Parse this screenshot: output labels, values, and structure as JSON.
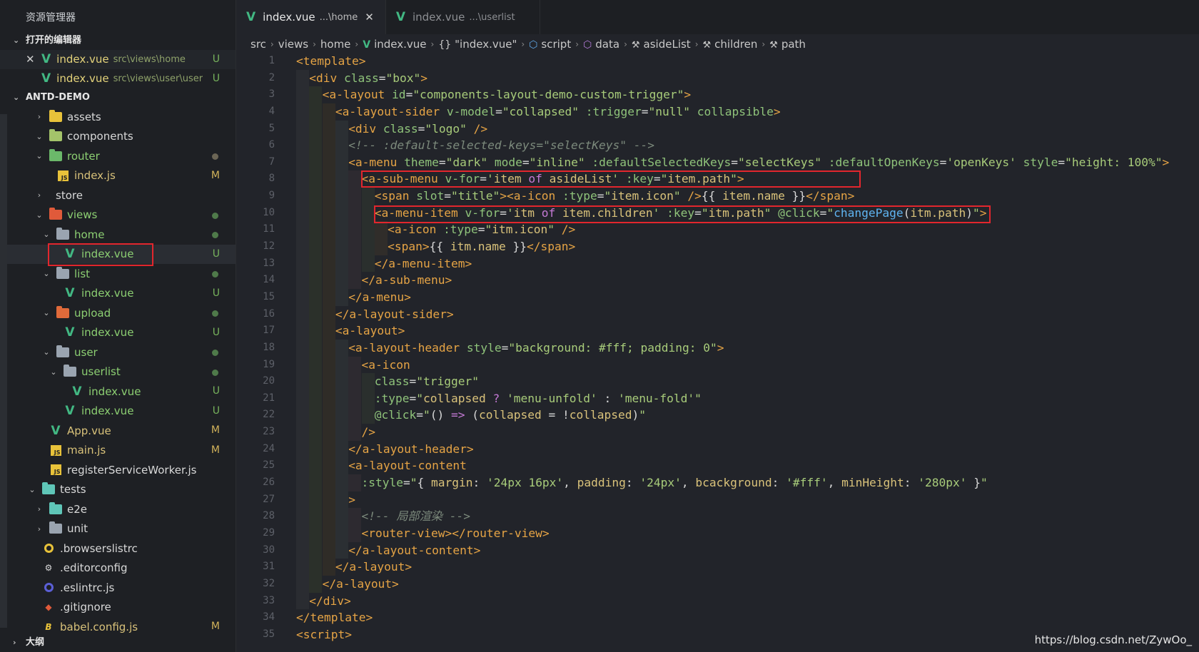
{
  "sidebar": {
    "title": "资源管理器",
    "open_editors_label": "打开的编辑器",
    "open_editors": [
      {
        "name": "index.vue",
        "path": "src\\views\\home",
        "badge": "U",
        "closable": true
      },
      {
        "name": "index.vue",
        "path": "src\\views\\user\\user...",
        "badge": "U",
        "closable": false
      }
    ],
    "project_label": "ANTD-DEMO",
    "tree": [
      {
        "label": "assets",
        "depth": 0,
        "chev": "›",
        "icon": "folder",
        "color": "#e8c23a",
        "badge": "",
        "dot": ""
      },
      {
        "label": "components",
        "depth": 0,
        "chev": "⌄",
        "icon": "folder",
        "color": "#a4c46a",
        "badge": "",
        "dot": ""
      },
      {
        "label": "router",
        "depth": 0,
        "chev": "⌄",
        "icon": "folder",
        "color": "#6bb86a",
        "badge": "",
        "dot": "#6b6555"
      },
      {
        "label": "index.js",
        "depth": 1,
        "chev": "",
        "icon": "js",
        "color": "#e8c23a",
        "badge": "M",
        "dot": ""
      },
      {
        "label": "store",
        "depth": 0,
        "chev": "›",
        "icon": "none",
        "color": "",
        "badge": "",
        "dot": ""
      },
      {
        "label": "views",
        "depth": 0,
        "chev": "⌄",
        "icon": "folder",
        "color": "#e05a3a",
        "badge": "",
        "dot": "#4f7a4a"
      },
      {
        "label": "home",
        "depth": 1,
        "chev": "⌄",
        "icon": "folder",
        "color": "#9aa4b0",
        "badge": "",
        "dot": "#4f7a4a"
      },
      {
        "label": "index.vue",
        "depth": 2,
        "chev": "",
        "icon": "vue",
        "color": "#42b883",
        "badge": "U",
        "dot": "",
        "selected": true
      },
      {
        "label": "list",
        "depth": 1,
        "chev": "⌄",
        "icon": "folder",
        "color": "#9aa4b0",
        "badge": "",
        "dot": "#4f7a4a"
      },
      {
        "label": "index.vue",
        "depth": 2,
        "chev": "",
        "icon": "vue",
        "color": "#42b883",
        "badge": "U",
        "dot": ""
      },
      {
        "label": "upload",
        "depth": 1,
        "chev": "⌄",
        "icon": "folder",
        "color": "#e06a3a",
        "badge": "",
        "dot": "#4f7a4a"
      },
      {
        "label": "index.vue",
        "depth": 2,
        "chev": "",
        "icon": "vue",
        "color": "#42b883",
        "badge": "U",
        "dot": ""
      },
      {
        "label": "user",
        "depth": 1,
        "chev": "⌄",
        "icon": "folder",
        "color": "#9aa4b0",
        "badge": "",
        "dot": "#4f7a4a"
      },
      {
        "label": "userlist",
        "depth": 2,
        "chev": "⌄",
        "icon": "folder",
        "color": "#9aa4b0",
        "badge": "",
        "dot": "#4f7a4a"
      },
      {
        "label": "index.vue",
        "depth": 3,
        "chev": "",
        "icon": "vue",
        "color": "#42b883",
        "badge": "U",
        "dot": ""
      },
      {
        "label": "index.vue",
        "depth": 2,
        "chev": "",
        "icon": "vue",
        "color": "#42b883",
        "badge": "U",
        "dot": ""
      },
      {
        "label": "App.vue",
        "depth": 0,
        "chev": "",
        "icon": "vue",
        "color": "#42b883",
        "badge": "M",
        "dot": ""
      },
      {
        "label": "main.js",
        "depth": 0,
        "chev": "",
        "icon": "js",
        "color": "#e8c23a",
        "badge": "M",
        "dot": ""
      },
      {
        "label": "registerServiceWorker.js",
        "depth": 0,
        "chev": "",
        "icon": "js",
        "color": "#e8c23a",
        "badge": "",
        "dot": ""
      },
      {
        "label": "tests",
        "depth": -1,
        "chev": "⌄",
        "icon": "folder",
        "color": "#5fc6b8",
        "badge": "",
        "dot": ""
      },
      {
        "label": "e2e",
        "depth": 0,
        "chev": "›",
        "icon": "folder",
        "color": "#5fc6b8",
        "badge": "",
        "dot": ""
      },
      {
        "label": "unit",
        "depth": 0,
        "chev": "›",
        "icon": "folder",
        "color": "#9aa4b0",
        "badge": "",
        "dot": ""
      },
      {
        "label": ".browserslistrc",
        "depth": -1,
        "chev": "",
        "icon": "circle",
        "color": "#e8c23a",
        "badge": "",
        "dot": ""
      },
      {
        "label": ".editorconfig",
        "depth": -1,
        "chev": "",
        "icon": "gear",
        "color": "#d8d8d8",
        "badge": "",
        "dot": ""
      },
      {
        "label": ".eslintrc.js",
        "depth": -1,
        "chev": "",
        "icon": "circle",
        "color": "#5b5fd6",
        "badge": "",
        "dot": ""
      },
      {
        "label": ".gitignore",
        "depth": -1,
        "chev": "",
        "icon": "diamond",
        "color": "#e05a3a",
        "badge": "",
        "dot": ""
      },
      {
        "label": "babel.config.js",
        "depth": -1,
        "chev": "",
        "icon": "babel",
        "color": "#e8c23a",
        "badge": "M",
        "dot": ""
      }
    ],
    "outline_label": "大纲"
  },
  "tabs": [
    {
      "name": "index.vue",
      "path": "...\\home",
      "active": true
    },
    {
      "name": "index.vue",
      "path": "...\\userlist",
      "active": false
    }
  ],
  "breadcrumb": [
    {
      "text": "src",
      "icon": ""
    },
    {
      "text": "views",
      "icon": ""
    },
    {
      "text": "home",
      "icon": ""
    },
    {
      "text": "index.vue",
      "icon": "vue"
    },
    {
      "text": "\"index.vue\"",
      "icon": "{}"
    },
    {
      "text": "script",
      "icon": "cube"
    },
    {
      "text": "data",
      "icon": "cube2"
    },
    {
      "text": "asideList",
      "icon": "wrench"
    },
    {
      "text": "children",
      "icon": "wrench"
    },
    {
      "text": "path",
      "icon": "wrench"
    }
  ],
  "code_lines": [
    {
      "n": "1",
      "indent": 0,
      "toks": [
        [
          "tag",
          "<template>"
        ]
      ]
    },
    {
      "n": "2",
      "indent": 1,
      "toks": [
        [
          "tag",
          "<div "
        ],
        [
          "attr",
          "class"
        ],
        [
          "punc",
          "="
        ],
        [
          "str",
          "\"box\""
        ],
        [
          "tag",
          ">"
        ]
      ]
    },
    {
      "n": "3",
      "indent": 2,
      "toks": [
        [
          "tag",
          "<a-layout "
        ],
        [
          "attr",
          "id"
        ],
        [
          "punc",
          "="
        ],
        [
          "str",
          "\"components-layout-demo-custom-trigger\""
        ],
        [
          "tag",
          ">"
        ]
      ]
    },
    {
      "n": "4",
      "indent": 3,
      "toks": [
        [
          "tag",
          "<a-layout-sider "
        ],
        [
          "attr",
          "v-model"
        ],
        [
          "punc",
          "="
        ],
        [
          "str",
          "\"collapsed\""
        ],
        [
          "txt",
          " "
        ],
        [
          "attr",
          ":trigger"
        ],
        [
          "punc",
          "="
        ],
        [
          "str",
          "\"null\""
        ],
        [
          "txt",
          " "
        ],
        [
          "attr",
          "collapsible"
        ],
        [
          "tag",
          ">"
        ]
      ]
    },
    {
      "n": "5",
      "indent": 4,
      "toks": [
        [
          "tag",
          "<div "
        ],
        [
          "attr",
          "class"
        ],
        [
          "punc",
          "="
        ],
        [
          "str",
          "\"logo\""
        ],
        [
          "tag",
          " />"
        ]
      ]
    },
    {
      "n": "6",
      "indent": 4,
      "toks": [
        [
          "cmt",
          "<!-- :default-selected-keys=\"selectKeys\" -->"
        ]
      ]
    },
    {
      "n": "7",
      "indent": 4,
      "toks": [
        [
          "tag",
          "<a-menu "
        ],
        [
          "attr",
          "theme"
        ],
        [
          "punc",
          "="
        ],
        [
          "str",
          "\"dark\""
        ],
        [
          "txt",
          " "
        ],
        [
          "attr",
          "mode"
        ],
        [
          "punc",
          "="
        ],
        [
          "str",
          "\"inline\""
        ],
        [
          "txt",
          " "
        ],
        [
          "attr",
          ":defaultSelectedKeys"
        ],
        [
          "punc",
          "="
        ],
        [
          "str",
          "\"selectKeys\""
        ],
        [
          "txt",
          " "
        ],
        [
          "attr",
          ":defaultOpenKeys"
        ],
        [
          "punc",
          "="
        ],
        [
          "str",
          "'openKeys'"
        ],
        [
          "txt",
          " "
        ],
        [
          "attr",
          "style"
        ],
        [
          "punc",
          "="
        ],
        [
          "str",
          "\"height: 100%\""
        ],
        [
          "tag",
          ">"
        ]
      ]
    },
    {
      "n": "8",
      "indent": 5,
      "toks": [
        [
          "tag",
          "<a-sub-menu "
        ],
        [
          "attr",
          "v-for"
        ],
        [
          "punc",
          "="
        ],
        [
          "str",
          "'"
        ],
        [
          "var",
          "item "
        ],
        [
          "kw",
          "of "
        ],
        [
          "var",
          "asideList"
        ],
        [
          "str",
          "'"
        ],
        [
          "txt",
          " "
        ],
        [
          "attr",
          ":key"
        ],
        [
          "punc",
          "="
        ],
        [
          "str",
          "\""
        ],
        [
          "var",
          "item.path"
        ],
        [
          "str",
          "\""
        ],
        [
          "tag",
          ">"
        ]
      ]
    },
    {
      "n": "9",
      "indent": 6,
      "toks": [
        [
          "tag",
          "<span "
        ],
        [
          "attr",
          "slot"
        ],
        [
          "punc",
          "="
        ],
        [
          "str",
          "\"title\""
        ],
        [
          "tag",
          "><a-icon "
        ],
        [
          "attr",
          ":type"
        ],
        [
          "punc",
          "="
        ],
        [
          "str",
          "\""
        ],
        [
          "var",
          "item.icon"
        ],
        [
          "str",
          "\""
        ],
        [
          "tag",
          " />"
        ],
        [
          "punc",
          "{{ "
        ],
        [
          "var",
          "item.name"
        ],
        [
          "punc",
          " }}"
        ],
        [
          "tag",
          "</span>"
        ]
      ]
    },
    {
      "n": "10",
      "indent": 6,
      "toks": [
        [
          "tag",
          "<a-menu-item "
        ],
        [
          "attr",
          "v-for"
        ],
        [
          "punc",
          "="
        ],
        [
          "str",
          "'"
        ],
        [
          "var",
          "itm "
        ],
        [
          "kw",
          "of "
        ],
        [
          "var",
          "item.children"
        ],
        [
          "str",
          "'"
        ],
        [
          "txt",
          " "
        ],
        [
          "attr",
          ":key"
        ],
        [
          "punc",
          "="
        ],
        [
          "str",
          "\""
        ],
        [
          "var",
          "itm.path"
        ],
        [
          "str",
          "\""
        ],
        [
          "txt",
          " "
        ],
        [
          "attr",
          "@click"
        ],
        [
          "punc",
          "="
        ],
        [
          "str",
          "\""
        ],
        [
          "fn",
          "changePage"
        ],
        [
          "punc",
          "("
        ],
        [
          "var",
          "itm.path"
        ],
        [
          "punc",
          ")"
        ],
        [
          "str",
          "\""
        ],
        [
          "tag",
          ">"
        ]
      ]
    },
    {
      "n": "11",
      "indent": 7,
      "toks": [
        [
          "tag",
          "<a-icon "
        ],
        [
          "attr",
          ":type"
        ],
        [
          "punc",
          "="
        ],
        [
          "str",
          "\""
        ],
        [
          "var",
          "itm.icon"
        ],
        [
          "str",
          "\""
        ],
        [
          "tag",
          " />"
        ]
      ]
    },
    {
      "n": "12",
      "indent": 7,
      "toks": [
        [
          "tag",
          "<span>"
        ],
        [
          "punc",
          "{{ "
        ],
        [
          "var",
          "itm.name"
        ],
        [
          "punc",
          " }}"
        ],
        [
          "tag",
          "</span>"
        ]
      ]
    },
    {
      "n": "13",
      "indent": 6,
      "toks": [
        [
          "tag",
          "</a-menu-item>"
        ]
      ]
    },
    {
      "n": "14",
      "indent": 5,
      "toks": [
        [
          "tag",
          "</a-sub-menu>"
        ]
      ]
    },
    {
      "n": "15",
      "indent": 4,
      "toks": [
        [
          "tag",
          "</a-menu>"
        ]
      ]
    },
    {
      "n": "16",
      "indent": 3,
      "toks": [
        [
          "tag",
          "</a-layout-sider>"
        ]
      ]
    },
    {
      "n": "17",
      "indent": 3,
      "toks": [
        [
          "tag",
          "<a-layout>"
        ]
      ]
    },
    {
      "n": "18",
      "indent": 4,
      "toks": [
        [
          "tag",
          "<a-layout-header "
        ],
        [
          "attr",
          "style"
        ],
        [
          "punc",
          "="
        ],
        [
          "str",
          "\"background: #fff; padding: 0\""
        ],
        [
          "tag",
          ">"
        ]
      ]
    },
    {
      "n": "19",
      "indent": 5,
      "toks": [
        [
          "tag",
          "<a-icon"
        ]
      ]
    },
    {
      "n": "20",
      "indent": 6,
      "toks": [
        [
          "attr",
          "class"
        ],
        [
          "punc",
          "="
        ],
        [
          "str",
          "\"trigger\""
        ]
      ]
    },
    {
      "n": "21",
      "indent": 6,
      "toks": [
        [
          "attr",
          ":type"
        ],
        [
          "punc",
          "="
        ],
        [
          "str",
          "\""
        ],
        [
          "var",
          "collapsed"
        ],
        [
          "kw",
          " ? "
        ],
        [
          "str",
          "'menu-unfold'"
        ],
        [
          "punc",
          " : "
        ],
        [
          "str",
          "'menu-fold'"
        ],
        [
          "str",
          "\""
        ]
      ]
    },
    {
      "n": "22",
      "indent": 6,
      "toks": [
        [
          "attr",
          "@click"
        ],
        [
          "punc",
          "="
        ],
        [
          "str",
          "\""
        ],
        [
          "punc",
          "() "
        ],
        [
          "kw",
          "=>"
        ],
        [
          "punc",
          " ("
        ],
        [
          "var",
          "collapsed"
        ],
        [
          "punc",
          " = !"
        ],
        [
          "var",
          "collapsed"
        ],
        [
          "punc",
          ")"
        ],
        [
          "str",
          "\""
        ]
      ]
    },
    {
      "n": "23",
      "indent": 5,
      "toks": [
        [
          "tag",
          "/>"
        ]
      ]
    },
    {
      "n": "24",
      "indent": 4,
      "toks": [
        [
          "tag",
          "</a-layout-header>"
        ]
      ]
    },
    {
      "n": "25",
      "indent": 4,
      "toks": [
        [
          "tag",
          "<a-layout-content"
        ]
      ]
    },
    {
      "n": "26",
      "indent": 5,
      "toks": [
        [
          "attr",
          ":style"
        ],
        [
          "punc",
          "="
        ],
        [
          "str",
          "\""
        ],
        [
          "punc",
          "{ "
        ],
        [
          "var",
          "margin"
        ],
        [
          "punc",
          ": "
        ],
        [
          "str",
          "'24px 16px'"
        ],
        [
          "punc",
          ", "
        ],
        [
          "var",
          "padding"
        ],
        [
          "punc",
          ": "
        ],
        [
          "str",
          "'24px'"
        ],
        [
          "punc",
          ", "
        ],
        [
          "var",
          "bcackground"
        ],
        [
          "punc",
          ": "
        ],
        [
          "str",
          "'#fff'"
        ],
        [
          "punc",
          ", "
        ],
        [
          "var",
          "minHeight"
        ],
        [
          "punc",
          ": "
        ],
        [
          "str",
          "'280px'"
        ],
        [
          "punc",
          " }"
        ],
        [
          "str",
          "\""
        ]
      ]
    },
    {
      "n": "27",
      "indent": 4,
      "toks": [
        [
          "tag",
          ">"
        ]
      ]
    },
    {
      "n": "28",
      "indent": 5,
      "toks": [
        [
          "cmt",
          "<!-- 局部渲染 -->"
        ]
      ]
    },
    {
      "n": "29",
      "indent": 5,
      "toks": [
        [
          "tag",
          "<router-view></router-view>"
        ]
      ]
    },
    {
      "n": "30",
      "indent": 4,
      "toks": [
        [
          "tag",
          "</a-layout-content>"
        ]
      ]
    },
    {
      "n": "31",
      "indent": 3,
      "toks": [
        [
          "tag",
          "</a-layout>"
        ]
      ]
    },
    {
      "n": "32",
      "indent": 2,
      "toks": [
        [
          "tag",
          "</a-layout>"
        ]
      ]
    },
    {
      "n": "33",
      "indent": 1,
      "toks": [
        [
          "tag",
          "</div>"
        ]
      ]
    },
    {
      "n": "34",
      "indent": 0,
      "toks": [
        [
          "tag",
          "</template>"
        ]
      ]
    },
    {
      "n": "35",
      "indent": 0,
      "toks": [
        [
          "tag",
          "<script>"
        ]
      ]
    }
  ],
  "watermark": "https://blog.csdn.net/ZywOo_",
  "colors": {
    "highlight_box": "#e2262d",
    "vue_green": "#42b883",
    "tag": "#e6a445"
  }
}
